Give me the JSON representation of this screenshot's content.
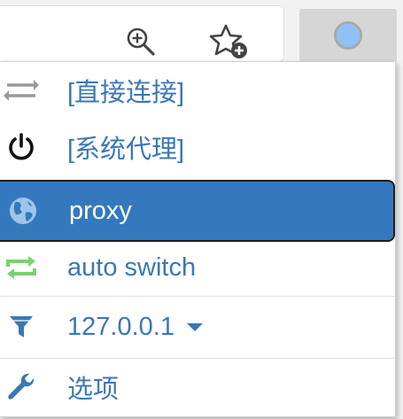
{
  "toolbar": {
    "zoom_icon": "zoom-in-icon",
    "bookmark_icon": "star-add-icon",
    "extension_icon": "switchyomega-icon"
  },
  "menu": {
    "items": [
      {
        "label": "[直接连接]",
        "icon": "direct-arrows-icon"
      },
      {
        "label": "[系统代理]",
        "icon": "power-icon"
      },
      {
        "label": "proxy",
        "icon": "globe-icon",
        "selected": true
      },
      {
        "label": "auto switch",
        "icon": "auto-switch-icon"
      },
      {
        "label": "127.0.0.1",
        "icon": "filter-icon"
      },
      {
        "label": "选项",
        "icon": "wrench-icon"
      }
    ]
  },
  "colors": {
    "accent": "#3479be",
    "label": "#3c77b5",
    "auto_switch_green": "#7ccf72",
    "extension_dot": "#8fc3f7"
  }
}
